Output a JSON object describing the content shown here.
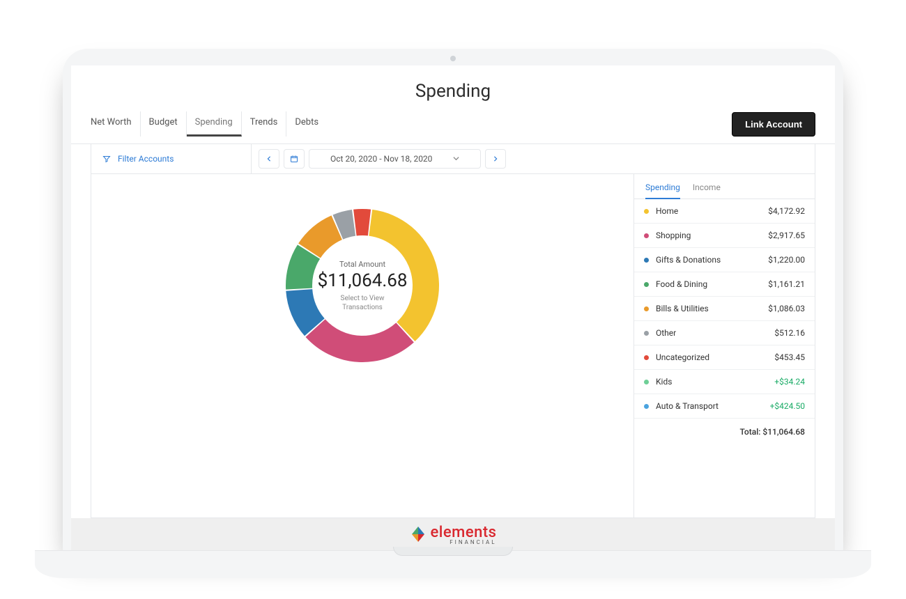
{
  "page_title": "Spending",
  "nav_tabs": [
    "Net Worth",
    "Budget",
    "Spending",
    "Trends",
    "Debts"
  ],
  "nav_active_index": 2,
  "link_account_label": "Link Account",
  "filter_accounts_label": "Filter Accounts",
  "date_range": "Oct 20, 2020 - Nov 18, 2020",
  "donut_center": {
    "label": "Total Amount",
    "amount": "$11,064.68",
    "sub1": "Select to View",
    "sub2": "Transactions"
  },
  "side_tabs": {
    "spending": "Spending",
    "income": "Income",
    "active": "spending"
  },
  "categories": [
    {
      "name": "Home",
      "amount": "$4,172.92",
      "value": 4172.92,
      "color": "#f3c32f",
      "positive": false
    },
    {
      "name": "Shopping",
      "amount": "$2,917.65",
      "value": 2917.65,
      "color": "#d04d78",
      "positive": false
    },
    {
      "name": "Gifts & Donations",
      "amount": "$1,220.00",
      "value": 1220.0,
      "color": "#2d79b5",
      "positive": false
    },
    {
      "name": "Food & Dining",
      "amount": "$1,161.21",
      "value": 1161.21,
      "color": "#4aa86a",
      "positive": false
    },
    {
      "name": "Bills & Utilities",
      "amount": "$1,086.03",
      "value": 1086.03,
      "color": "#e99a2b",
      "positive": false
    },
    {
      "name": "Other",
      "amount": "$512.16",
      "value": 512.16,
      "color": "#9aa0a6",
      "positive": false
    },
    {
      "name": "Uncategorized",
      "amount": "$453.45",
      "value": 453.45,
      "color": "#e24a3b",
      "positive": false
    },
    {
      "name": "Kids",
      "amount": "+$34.24",
      "value": 34.24,
      "color": "#6fcf97",
      "positive": true
    },
    {
      "name": "Auto & Transport",
      "amount": "+$424.50",
      "value": 424.5,
      "color": "#4aa3df",
      "positive": true
    }
  ],
  "total_label": "Total: $11,064.68",
  "logo": {
    "brand": "elements",
    "sub": "FINANCIAL"
  },
  "chart_data": {
    "type": "pie",
    "title": "Total Amount $11,064.68",
    "series": [
      {
        "name": "Home",
        "value": 4172.92,
        "color": "#f3c32f"
      },
      {
        "name": "Shopping",
        "value": 2917.65,
        "color": "#d04d78"
      },
      {
        "name": "Gifts & Donations",
        "value": 1220.0,
        "color": "#2d79b5"
      },
      {
        "name": "Food & Dining",
        "value": 1161.21,
        "color": "#4aa86a"
      },
      {
        "name": "Bills & Utilities",
        "value": 1086.03,
        "color": "#e99a2b"
      },
      {
        "name": "Other",
        "value": 512.16,
        "color": "#9aa0a6"
      },
      {
        "name": "Uncategorized",
        "value": 453.45,
        "color": "#e24a3b"
      }
    ]
  }
}
